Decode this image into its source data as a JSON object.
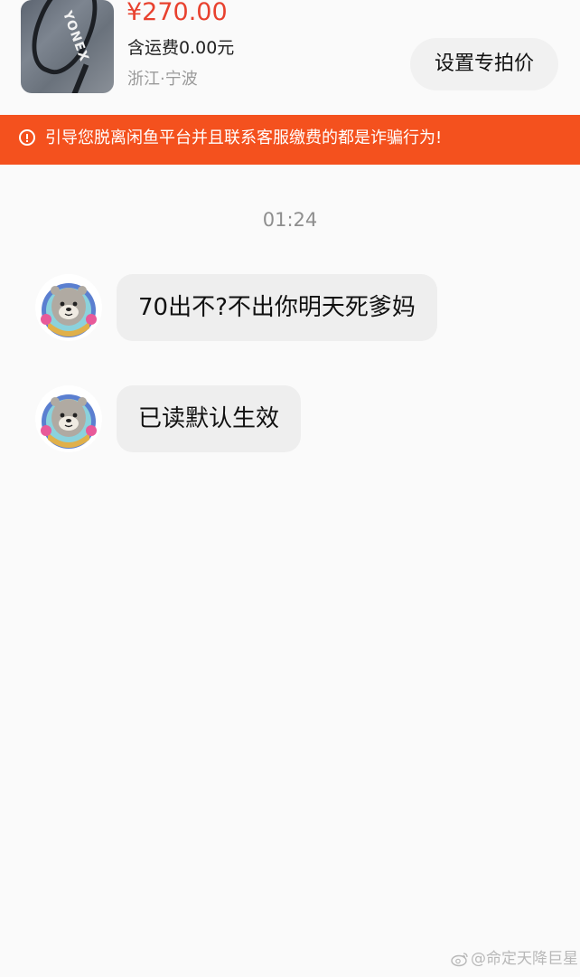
{
  "product": {
    "image_alt": "YONEX racket",
    "brand_text": "YONEX",
    "price": "¥270.00",
    "shipping": "含运费0.00元",
    "location": "浙江·宁波",
    "set_price_label": "设置专拍价"
  },
  "warning": {
    "icon": "info-circle-icon",
    "text": "引导您脱离闲鱼平台并且联系客服缴费的都是诈骗行为!"
  },
  "chat": {
    "timestamp": "01:24",
    "messages": [
      {
        "sender": "other",
        "avatar_icon": "sea-otter-avatar",
        "text": "70出不?不出你明天死爹妈"
      },
      {
        "sender": "other",
        "avatar_icon": "sea-otter-avatar",
        "text": "已读默认生效"
      }
    ]
  },
  "watermark": {
    "icon": "weibo-logo",
    "text": "@命定天降巨星"
  },
  "colors": {
    "price": "#e8412e",
    "warning_banner": "#f4511e",
    "bubble": "#eeeeee",
    "background": "#fafafa"
  }
}
